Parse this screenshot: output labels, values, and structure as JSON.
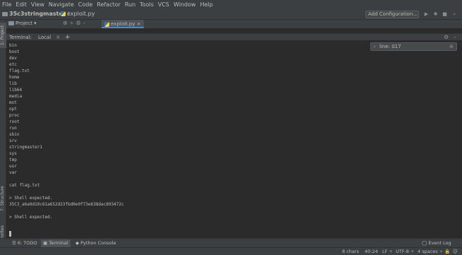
{
  "menu": [
    "File",
    "Edit",
    "View",
    "Navigate",
    "Code",
    "Refactor",
    "Run",
    "Tools",
    "VCS",
    "Window",
    "Help"
  ],
  "navbar": {
    "project": "35c3stringmaster",
    "file": "exploit.py",
    "run_config": "Add Configuration..."
  },
  "project_panel": {
    "title": "Project",
    "tab_label": "exploit.py"
  },
  "terminal": {
    "title": "Terminal:",
    "tab": "Local",
    "add": "+",
    "search": "line: 017",
    "lines": [
      "bin",
      "boot",
      "dev",
      "etc",
      "flag.txt",
      "home",
      "lib",
      "lib64",
      "media",
      "mnt",
      "opt",
      "proc",
      "root",
      "run",
      "sbin",
      "srv",
      "stringmaster1",
      "sys",
      "tmp",
      "usr",
      "var",
      "",
      "cat flag.txt",
      "",
      "> Shell expected.",
      "35C3_a6a9d10c61a652d23fbd0e9f73e638dac893472c",
      "",
      "> Shell expected."
    ]
  },
  "side_tabs": {
    "project": "1: Project",
    "structure": "7: Structure",
    "favorites": "2: Favorites"
  },
  "tool_windows": [
    "6: TODO",
    "Terminal",
    "Python Console"
  ],
  "event_log": "Event Log",
  "status": {
    "chars": "8 chars",
    "position": "40:24",
    "line_sep": "LF",
    "encoding": "UTF-8",
    "indent": "4 spaces"
  },
  "icons": {
    "project-folder": "folder-icon",
    "python-file": "python-file-icon"
  }
}
